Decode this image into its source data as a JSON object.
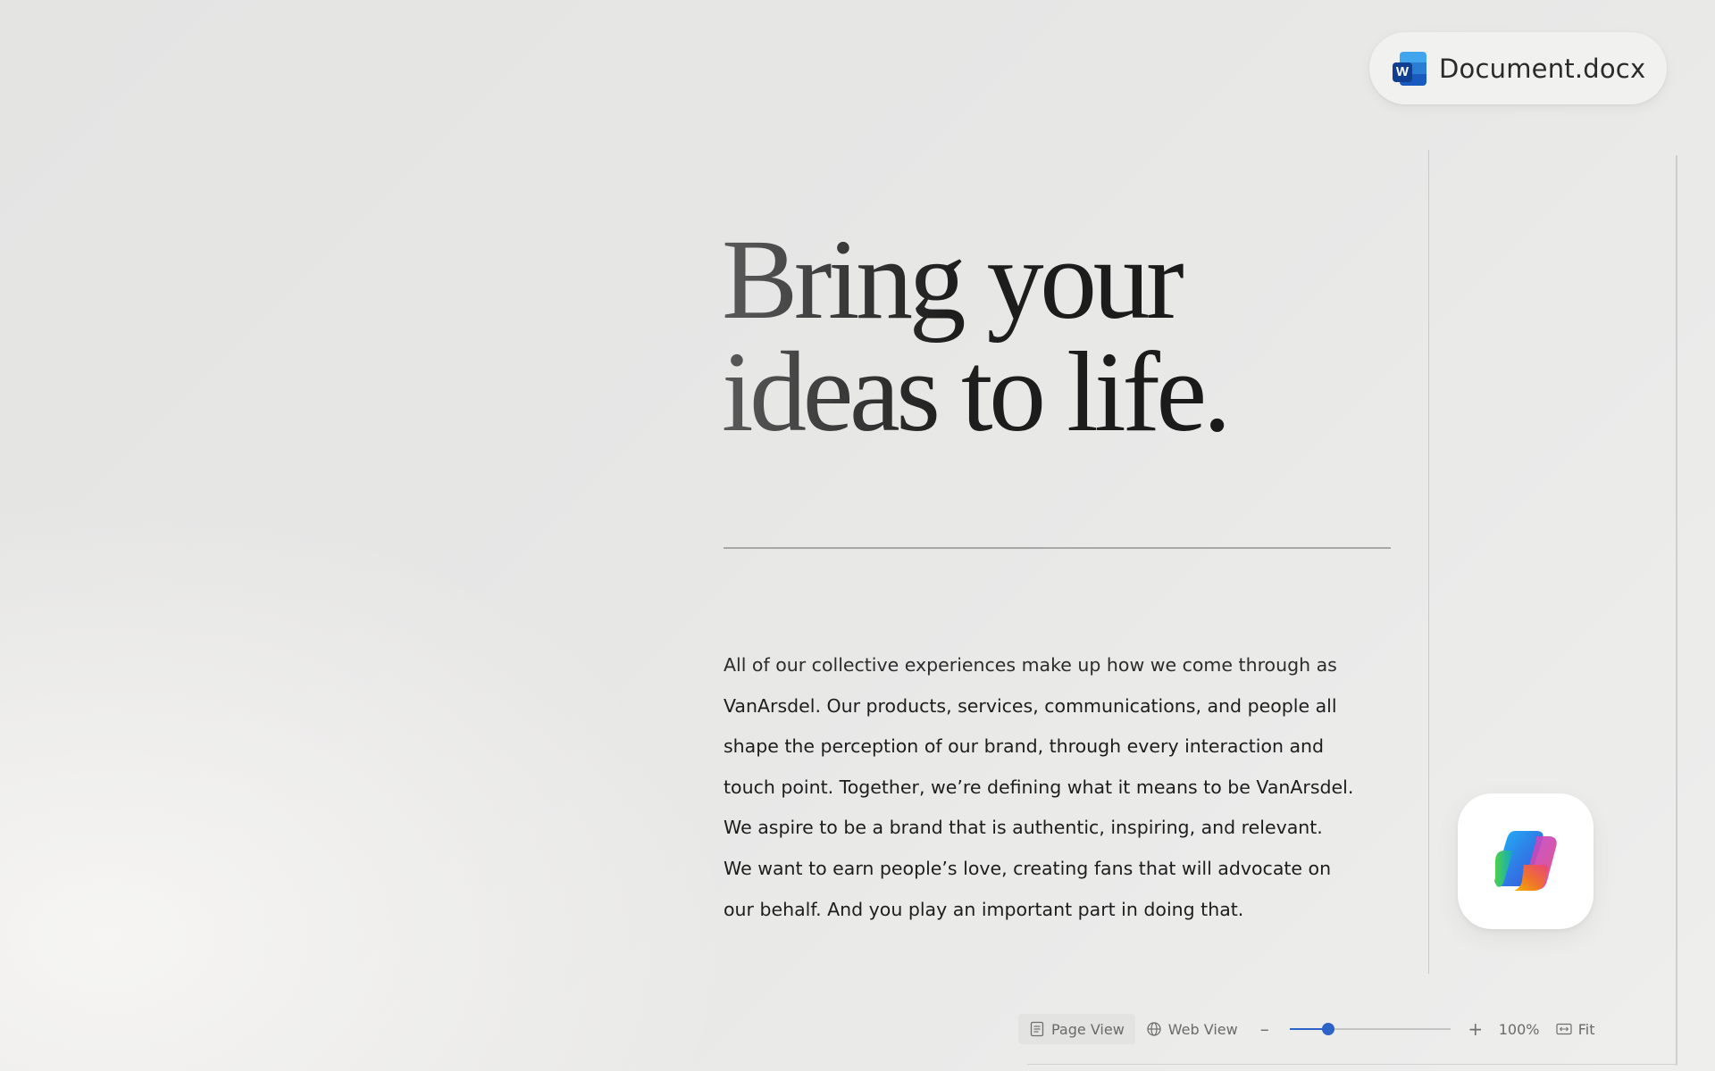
{
  "window": {
    "document_name": "Document.docx",
    "app_icon": "word-icon"
  },
  "document": {
    "headline_line1": "Bring your",
    "headline_line2": "ideas to life.",
    "body_lines": [
      "All of our collective experiences make up how we come through as",
      "VanArsdel. Our products, services, communications, and people all",
      "shape the perception of our brand, through every interaction and",
      "touch point. Together, we’re defining what it means to be VanArsdel.",
      "We aspire to be a brand that is authentic, inspiring, and relevant.",
      "We want to earn people’s love, creating fans that will advocate on",
      "our behalf. And you play an important part in doing that."
    ]
  },
  "copilot": {
    "icon": "copilot-icon"
  },
  "statusbar": {
    "page_view_label": "Page View",
    "web_view_label": "Web View",
    "zoom_out_label": "–",
    "zoom_in_label": "+",
    "zoom_level": "100%",
    "zoom_slider_fraction": 0.24,
    "fit_label": "Fit"
  },
  "colors": {
    "accent": "#2d63c8",
    "word_blue": "#185abd"
  }
}
